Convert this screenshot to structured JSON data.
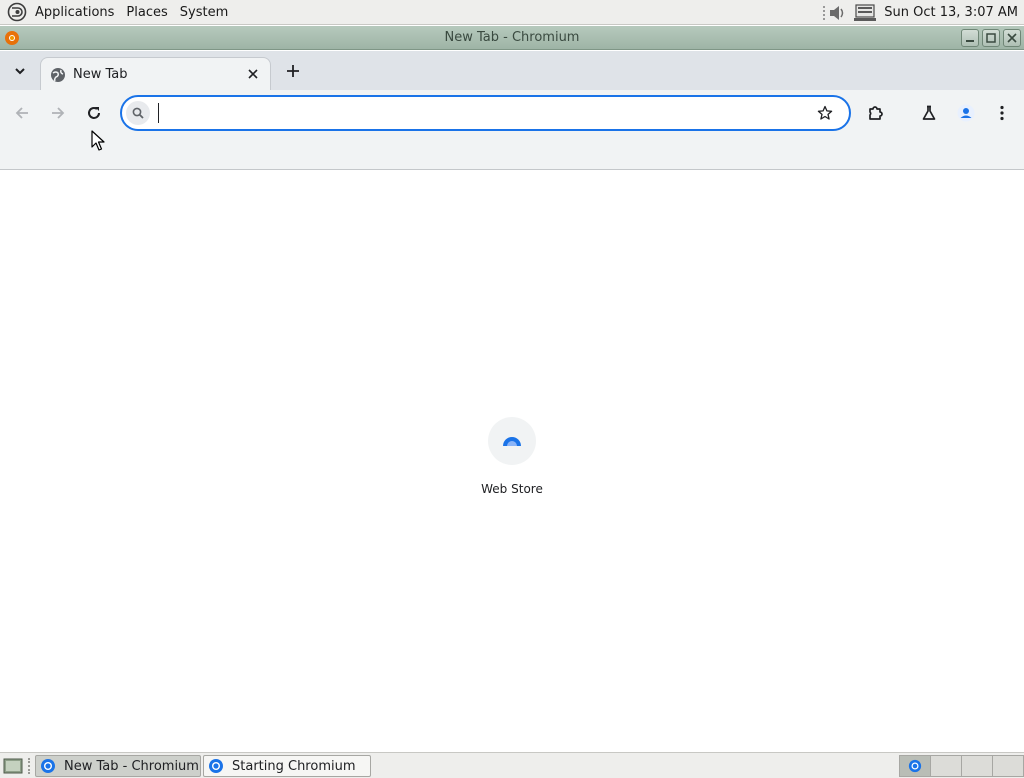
{
  "top_panel": {
    "menus": [
      {
        "label": "Applications"
      },
      {
        "label": "Places"
      },
      {
        "label": "System"
      }
    ],
    "clock": "Sun Oct 13,  3:07 AM",
    "icons": [
      "distro-logo-icon",
      "volume-icon",
      "network-icon"
    ]
  },
  "window": {
    "title": "New Tab - Chromium"
  },
  "browser": {
    "tabs": [
      {
        "title": "New Tab",
        "active": true
      }
    ],
    "omnibox": {
      "value": "",
      "placeholder": ""
    },
    "colors": {
      "accent": "#1a73e8",
      "toolbar_bg": "#f1f3f4",
      "tabstrip_bg": "#dfe3e8"
    }
  },
  "new_tab_page": {
    "shortcuts": [
      {
        "label": "Web Store",
        "icon": "web-store-icon"
      }
    ]
  },
  "taskbar": {
    "tasks": [
      {
        "label": "New Tab - Chromium",
        "active": true
      },
      {
        "label": "Starting Chromium",
        "active": false
      }
    ],
    "workspaces": 4,
    "active_workspace": 1
  }
}
